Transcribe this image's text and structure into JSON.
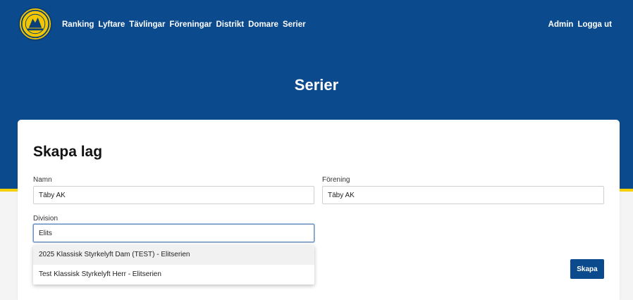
{
  "nav": {
    "items": [
      "Ranking",
      "Lyftare",
      "Tävlingar",
      "Föreningar",
      "Distrikt",
      "Domare",
      "Serier"
    ],
    "right": [
      "Admin",
      "Logga ut"
    ]
  },
  "hero": {
    "title": "Serier"
  },
  "form": {
    "title": "Skapa lag",
    "name_label": "Namn",
    "name_value": "Täby AK",
    "club_label": "Förening",
    "club_value": "Täby AK",
    "division_label": "Division",
    "division_value": "Elits",
    "suggestions": [
      "2025 Klassisk Styrkelyft Dam (TEST) - Elitserien",
      "Test Klassisk Styrkelyft Herr - Elitserien"
    ],
    "submit_label": "Skapa"
  },
  "colors": {
    "primary": "#0b4a8c",
    "accent": "#f5d000",
    "background": "#f4f4f4"
  },
  "icons": {
    "logo": "federation-logo"
  }
}
